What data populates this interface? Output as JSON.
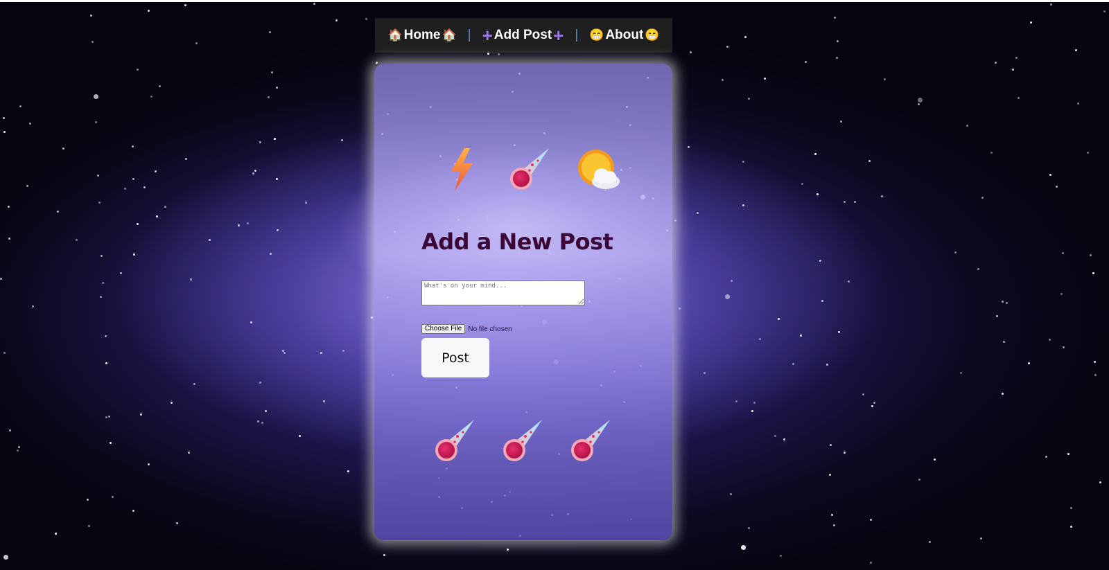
{
  "nav": {
    "home": {
      "emoji_left": "🏠",
      "label": "Home",
      "emoji_right": "🏠"
    },
    "separator": "|",
    "add_post": {
      "emoji_left": "+",
      "label": "Add Post",
      "emoji_right": "+"
    },
    "about": {
      "emoji_left": "😁",
      "label": "About",
      "emoji_right": "😁"
    }
  },
  "form": {
    "title": "Add a New Post",
    "textarea_placeholder": "What's on your mind...",
    "textarea_value": "",
    "file_button_label": "Choose File",
    "file_status": "No file chosen",
    "submit_label": "Post"
  },
  "decorations": {
    "top_icons": [
      "lightning-icon",
      "comet-icon",
      "sun-behind-cloud-icon"
    ],
    "bottom_icons": [
      "comet-icon",
      "comet-icon",
      "comet-icon"
    ]
  },
  "colors": {
    "title": "#3a0736",
    "nav_bg": "#1f1f1f",
    "nav_separator": "#4d8cd6",
    "plus": "#9b7be0"
  }
}
